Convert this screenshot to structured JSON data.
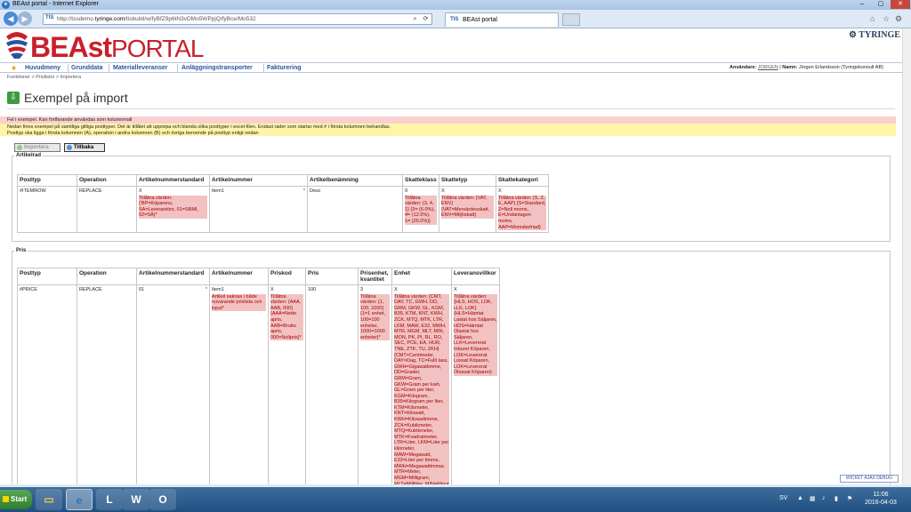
{
  "browser": {
    "window_title": "BEAst portal - Internet Explorer",
    "url_prefix": "http://tssdemo.",
    "url_host": "tyringe.com",
    "url_path": "/tisbuild/w/fyBfZ9p6tN3vDMo5WPpjQ/fyBce/Mo532",
    "tab_title": "BEAst portal",
    "icon_ie": "e",
    "tab_icon": "TIS"
  },
  "header": {
    "logo_beast": "BEAst",
    "logo_portal": "PORTAL",
    "brand": "TYRINGE"
  },
  "menu": {
    "items": [
      "Huvudmeny",
      "Grunddata",
      "Materialleveranser",
      "Anläggningstransporter",
      "Fakturering"
    ],
    "user_label": "Användare:",
    "user_name": "JORGEN",
    "name_label": "Namn:",
    "name_value": "Jörgen Erlandsson (Tyringekonsult AB)"
  },
  "breadcrumb": "Funktioner > Prislistor > Importera",
  "page_title": "Exempel på import",
  "messages": {
    "error": "Fel i exempel. Kan fortfarande användas som kolumnmall",
    "info_1": "Nedan finns exempel på samtliga giltiga posttyper. Det är tillåtet att upprepa och blanda olika posttyper i excel-filen. Endast rader som startar med # i första kolumnen behandlas.",
    "info_2": "Posttyp ska ligga i första kolumnen (A), operation i andra kolumnen (B) och övriga beroende på posttyp enligt nedan"
  },
  "buttons": {
    "importera": "Importera",
    "tillbaka": "Tillbaka"
  },
  "artikelrad": {
    "legend": "Artikelrad",
    "headers": [
      "Posttyp",
      "Operation",
      "Artikelnummerstandard",
      "Artikelnummer",
      "Artikelbenämning",
      "Skatteklass",
      "Skattetyp",
      "Skattekategori"
    ],
    "row": {
      "posttyp": "#ITEMROW",
      "operation": "REPLACE",
      "standard_val": "X",
      "standard_err": "Tillåtna värden: {'BP=Köparens, SA=Leverantörs, 01=SBMI, 02=SÄ}*",
      "artnr_val": "Item1",
      "benamning": "Desc",
      "klass_val": "9",
      "klass_err": "Tillåtna värden: {3, 4, 1} {3= (6.0%), 4= (12.0%), 1= (25.0%)}",
      "typ_val": "X",
      "typ_err": "Tillåtna värden: {VAT, ENV} {VAT=Mervärdesskatt, ENV=Miljöskatt}",
      "kat_val": "X",
      "kat_err": "Tillåtna värden: {S, Z, E, AAP} {S=Standard, Z=Noll moms, E=Undantagen moms, AAP=Momsbefriad}"
    },
    "required_mark": "*"
  },
  "pris": {
    "legend": "Pris",
    "headers": [
      "Posttyp",
      "Operation",
      "Artikelnummerstandard",
      "Artikelnummer",
      "Priskod",
      "Pris",
      "Prisenhet, kvantitet",
      "Enhet",
      "Leveransvillkor"
    ],
    "row": {
      "posttyp": "#PRICE",
      "operation": "REPLACE",
      "standard_val": "01",
      "artnr_val": "Item1",
      "artnr_err": "Artikel saknas i både nuvarande prislista och input*",
      "priskod_val": "X",
      "priskod_err": "Tillåtna värden: {AAA, AAB, 000} {AAA=Netto apris, AAB=Brutto apris, 000=Nollpris}*",
      "pris_val": "100",
      "prisenhet_val": "3",
      "prisenhet_err": "Tillåtna värden: {1, 100, 1000} {1=1 enhet, 100=100 enheter, 1000=1000 enheter}*",
      "enhet_val": "X",
      "enhet_err": "Tillåtna värden: {CMT, DAY, TC, GWH, DD, GRM, GKW, GL, KGM, B35, KTM, KNT, KWH, ZCK, MTQ, MTK, LTR, LKM, MAW, E32, MWH, MTR, MGM, MLT, MIN, MON, PK, PI, RL, RO, SEC, PCE, EA, HUR, TNE, ZTK, TU, ZKH} {CMT=Centimeter, DAY=Dag, TC=Fullt lass, GWH=Gigawattimme, DD=Grader, GRM=Gram, GKW=Gram per kwh, GL=Gram per liter, KGM=Kilogram, B35=Kilogram per liter, KTM=Kilometer, KNT=Kilowatt, KWH=Kilowattimme, ZCK=Kubikmeter, MTQ=Kubikmeter, MTK=Kvadratmeter, LTR=Liter, LKM=Liter per kilometer, MAW=Megawatt, E32=Liter per timme, MWH=Megawattimmar, MTR=Meter, MGM=Milligram, MLT=Milliliter, MIN=Minut",
      "lev_val": "X",
      "lev_err": "Tillåtna värden: {HLS, HOS, LOK, LLK, LOK} {HLS=Hämtat Lastat hos Säljaren, HOS=Hämtat Olastat hos Säljaren, LLK=Levererat Inburet Köparen, LOK=Levererat Lossat Köparen, LOK=Levererat Olossat Köparen}"
    },
    "required_mark": "*"
  },
  "debug_button": "WICKET AJAX DEBUG",
  "taskbar": {
    "start": "Start",
    "lang": "SV",
    "time": "11:06",
    "date": "2016-04-03"
  }
}
